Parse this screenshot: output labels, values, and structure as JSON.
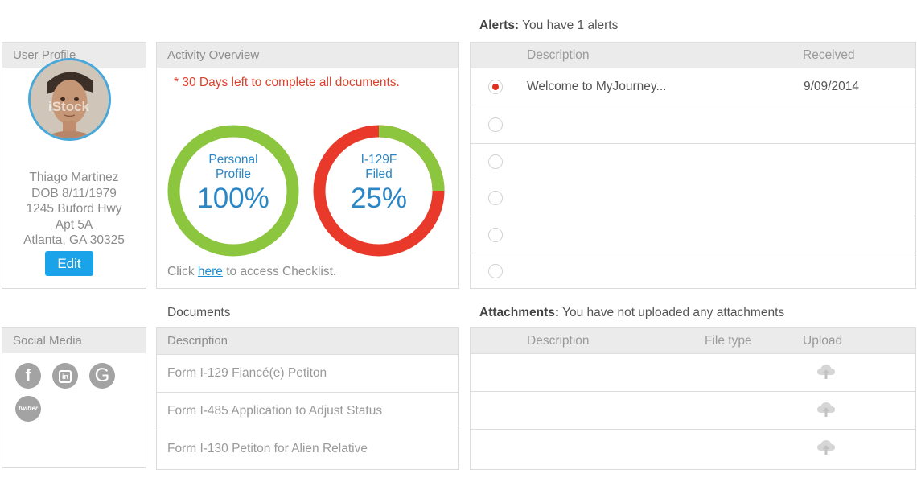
{
  "user_profile": {
    "title": "User Profile",
    "name": "Thiago Martinez",
    "dob": "DOB 8/11/1979",
    "address1": "1245 Buford Hwy",
    "address2": "Apt 5A",
    "city": "Atlanta, GA 30325",
    "edit_label": "Edit",
    "avatar_watermark": "iStock"
  },
  "activity": {
    "title": "Activity Overview",
    "warning": "* 30 Days left to complete all documents.",
    "rings": [
      {
        "line1": "Personal",
        "line2": "Profile",
        "percent_label": "100%",
        "progress": 1.0,
        "color": "#8cc63f"
      },
      {
        "line1": "I-129F",
        "line2": "Filed",
        "percent_label": "25%",
        "progress": 0.25,
        "color": "#8cc63f",
        "remaining_color": "#e8392b"
      }
    ],
    "checklist_prefix": "Click ",
    "checklist_link": "here",
    "checklist_suffix": " to access Checklist."
  },
  "alerts": {
    "title_bold": "Alerts:",
    "title_rest": " You have 1 alerts",
    "col_description": "Description",
    "col_received": "Received",
    "rows": [
      {
        "description": "Welcome to MyJourney...",
        "received": "9/09/2014",
        "selected": true
      },
      {
        "description": "",
        "received": "",
        "selected": false
      },
      {
        "description": "",
        "received": "",
        "selected": false
      },
      {
        "description": "",
        "received": "",
        "selected": false
      },
      {
        "description": "",
        "received": "",
        "selected": false
      },
      {
        "description": "",
        "received": "",
        "selected": false
      }
    ]
  },
  "social_media": {
    "title": "Social Media",
    "icons": [
      {
        "name": "facebook-icon",
        "glyph": "f"
      },
      {
        "name": "linkedin-icon",
        "glyph": "in"
      },
      {
        "name": "google-icon",
        "glyph": "G"
      },
      {
        "name": "twitter-icon",
        "glyph": "twitter"
      }
    ]
  },
  "documents": {
    "title": "Documents",
    "col_description": "Description",
    "rows": [
      "Form I-129 Fiancé(e) Petiton",
      "Form I-485 Application to Adjust Status",
      "Form I-130 Petiton for Alien Relative"
    ]
  },
  "attachments": {
    "title_bold": "Attachments:",
    "title_rest": " You have not uploaded any attachments",
    "col_description": "Description",
    "col_filetype": "File type",
    "col_upload": "Upload",
    "rows": 3,
    "upload_icon": "cloud-upload-icon"
  },
  "colors": {
    "accent": "#1aa3e8",
    "alert": "#e22d22",
    "ring_green": "#8cc63f",
    "ring_red": "#e8392b"
  }
}
